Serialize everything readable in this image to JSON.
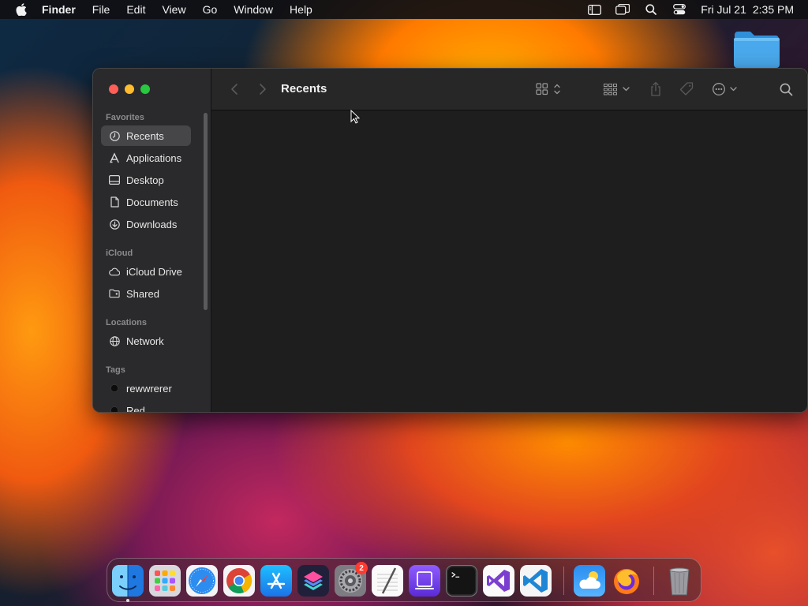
{
  "menubar": {
    "app_name": "Finder",
    "items": [
      "File",
      "Edit",
      "View",
      "Go",
      "Window",
      "Help"
    ],
    "date": "Fri Jul 21",
    "time": "2:35 PM",
    "status_icons": [
      "sidebar-icon",
      "screen-mirroring-icon",
      "spotlight-search-icon",
      "control-center-icon"
    ]
  },
  "window": {
    "title": "Recents",
    "traffic_lights": [
      "close",
      "minimize",
      "zoom"
    ],
    "sidebar": {
      "sections": [
        {
          "label": "Favorites",
          "items": [
            {
              "label": "Recents",
              "icon": "clock-icon",
              "selected": true
            },
            {
              "label": "Applications",
              "icon": "applications-icon",
              "selected": false
            },
            {
              "label": "Desktop",
              "icon": "desktop-icon",
              "selected": false
            },
            {
              "label": "Documents",
              "icon": "document-icon",
              "selected": false
            },
            {
              "label": "Downloads",
              "icon": "download-icon",
              "selected": false
            }
          ]
        },
        {
          "label": "iCloud",
          "items": [
            {
              "label": "iCloud Drive",
              "icon": "cloud-icon",
              "selected": false
            },
            {
              "label": "Shared",
              "icon": "shared-folder-icon",
              "selected": false
            }
          ]
        },
        {
          "label": "Locations",
          "items": [
            {
              "label": "Network",
              "icon": "globe-icon",
              "selected": false
            }
          ]
        },
        {
          "label": "Tags",
          "items": [
            {
              "label": "rewwrerer",
              "icon": "tag-dot-icon",
              "color": "#111111"
            },
            {
              "label": "Red",
              "icon": "tag-dot-icon",
              "color": "#111111"
            }
          ]
        }
      ]
    },
    "toolbar": {
      "buttons": [
        "back-icon",
        "forward-icon",
        "view-grid-icon",
        "group-icon",
        "share-icon",
        "tag-icon",
        "more-actions-icon",
        "search-icon"
      ]
    }
  },
  "dock": {
    "apps": [
      {
        "name": "Finder",
        "icon": "finder-icon",
        "running": true
      },
      {
        "name": "Launchpad",
        "icon": "launchpad-icon"
      },
      {
        "name": "Safari",
        "icon": "safari-icon"
      },
      {
        "name": "Google Chrome",
        "icon": "chrome-icon"
      },
      {
        "name": "App Store",
        "icon": "app-store-icon"
      },
      {
        "name": "Shortcuts",
        "icon": "shortcuts-icon"
      },
      {
        "name": "System Settings",
        "icon": "settings-icon",
        "badge": "2"
      },
      {
        "name": "TextEdit",
        "icon": "textedit-icon"
      },
      {
        "name": "Simulator",
        "icon": "simulator-icon"
      },
      {
        "name": "Terminal",
        "icon": "terminal-icon"
      },
      {
        "name": "Visual Studio",
        "icon": "visual-studio-icon"
      },
      {
        "name": "Visual Studio Code",
        "icon": "vscode-icon"
      },
      {
        "name": "Weather",
        "icon": "weather-icon"
      },
      {
        "name": "Firefox",
        "icon": "firefox-icon"
      },
      {
        "name": "Trash",
        "icon": "trash-icon"
      }
    ]
  },
  "colors": {
    "accent_red": "#ff5f57",
    "accent_yellow": "#febc2e",
    "accent_green": "#28c840",
    "badge": "#ff3b30"
  }
}
